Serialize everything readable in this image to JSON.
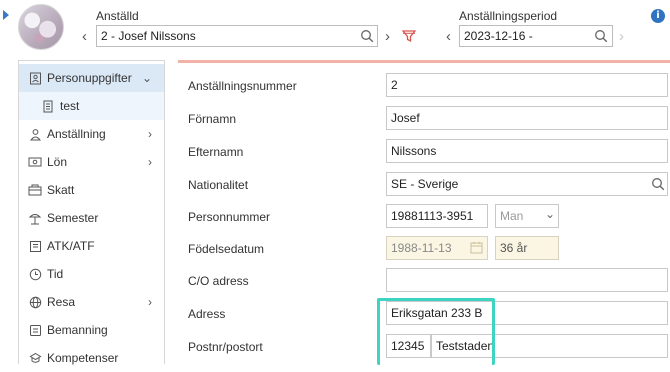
{
  "header": {
    "employee_label": "Anställd",
    "employee_value": "2 - Josef Nilssons",
    "period_label": "Anställningsperiod",
    "period_value": "2023-12-16 -",
    "info_glyph": "i"
  },
  "sidebar": {
    "items": [
      {
        "label": "Personuppgifter",
        "icon": "person-card-icon",
        "state": "active",
        "caret": "chevron-down"
      },
      {
        "label": "test",
        "icon": "document-icon",
        "state": "sub"
      },
      {
        "label": "Anställning",
        "icon": "person-icon",
        "caret": "chevron-right"
      },
      {
        "label": "Lön",
        "icon": "money-icon",
        "caret": "chevron-right"
      },
      {
        "label": "Skatt",
        "icon": "tax-icon"
      },
      {
        "label": "Semester",
        "icon": "vacation-icon"
      },
      {
        "label": "ATK/ATF",
        "icon": "atk-icon"
      },
      {
        "label": "Tid",
        "icon": "clock-icon"
      },
      {
        "label": "Resa",
        "icon": "globe-icon",
        "caret": "chevron-right"
      },
      {
        "label": "Bemanning",
        "icon": "staffing-icon"
      },
      {
        "label": "Kompetenser",
        "icon": "skills-icon"
      }
    ]
  },
  "form": {
    "employment_number_label": "Anställningsnummer",
    "employment_number": "2",
    "first_name_label": "Förnamn",
    "first_name": "Josef",
    "last_name_label": "Efternamn",
    "last_name": "Nilssons",
    "nationality_label": "Nationalitet",
    "nationality": "SE - Sverige",
    "personal_number_label": "Personnummer",
    "personal_number": "19881113-3951",
    "gender": "Man",
    "birth_date_label": "Födelsedatum",
    "birth_date": "1988-11-13",
    "age": "36 år",
    "co_address_label": "C/O adress",
    "co_address": "",
    "address_label": "Adress",
    "address": "Eriksgatan 233 B",
    "postal_label": "Postnr/postort",
    "postal_code": "12345",
    "city": "Teststaden"
  },
  "colors": {
    "accent_blue": "#3a78c3",
    "active_nav": "#dbe9f7",
    "highlight": "#3ed3c3",
    "accent_line": "#f0b3a6",
    "disabled_field": "#fbf6e4"
  }
}
